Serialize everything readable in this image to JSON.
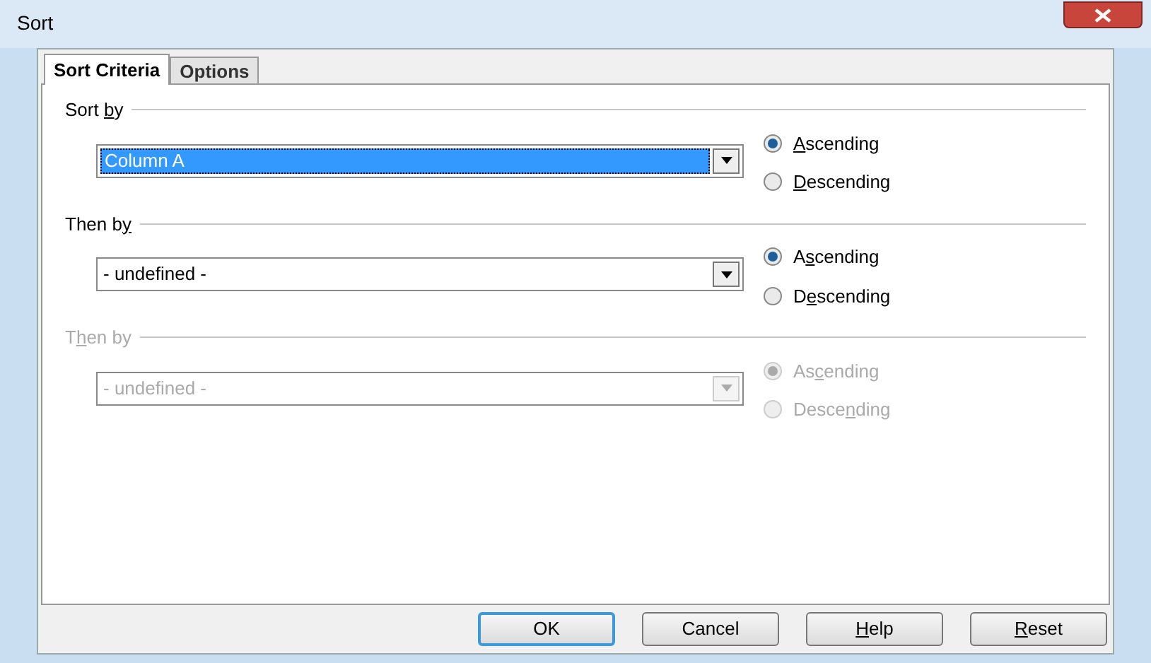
{
  "window": {
    "title": "Sort"
  },
  "tabs": [
    {
      "label": "Sort Criteria",
      "selected": true
    },
    {
      "label": "Options",
      "selected": false
    }
  ],
  "groups": [
    {
      "label": [
        {
          "text": "Sort ",
          "underline": false
        },
        {
          "text": "b",
          "underline": true
        },
        {
          "text": "y",
          "underline": false
        }
      ],
      "disabled": false,
      "combo": {
        "value": "Column A",
        "focused": true
      },
      "options": [
        {
          "label": [
            {
              "text": "A",
              "underline": true
            },
            {
              "text": "scending",
              "underline": false
            }
          ],
          "selected": true
        },
        {
          "label": [
            {
              "text": "D",
              "underline": true
            },
            {
              "text": "escending",
              "underline": false
            }
          ],
          "selected": false
        }
      ]
    },
    {
      "label": [
        {
          "text": "Then b",
          "underline": false
        },
        {
          "text": "y",
          "underline": true
        }
      ],
      "disabled": false,
      "combo": {
        "value": "- undefined -",
        "focused": false
      },
      "options": [
        {
          "label": [
            {
              "text": "A",
              "underline": false
            },
            {
              "text": "s",
              "underline": true
            },
            {
              "text": "cending",
              "underline": false
            }
          ],
          "selected": true
        },
        {
          "label": [
            {
              "text": "D",
              "underline": false
            },
            {
              "text": "e",
              "underline": true
            },
            {
              "text": "scending",
              "underline": false
            }
          ],
          "selected": false
        }
      ]
    },
    {
      "label": [
        {
          "text": "T",
          "underline": false
        },
        {
          "text": "h",
          "underline": true
        },
        {
          "text": "en by",
          "underline": false
        }
      ],
      "disabled": true,
      "combo": {
        "value": "- undefined -",
        "focused": false
      },
      "options": [
        {
          "label": [
            {
              "text": "As",
              "underline": false
            },
            {
              "text": "c",
              "underline": true
            },
            {
              "text": "ending",
              "underline": false
            }
          ],
          "selected": true
        },
        {
          "label": [
            {
              "text": "Desce",
              "underline": false
            },
            {
              "text": "n",
              "underline": true
            },
            {
              "text": "ding",
              "underline": false
            }
          ],
          "selected": false
        }
      ]
    }
  ],
  "buttons": [
    {
      "label": [
        {
          "text": "OK",
          "underline": false
        }
      ],
      "default": true
    },
    {
      "label": [
        {
          "text": "Cancel",
          "underline": false
        }
      ],
      "default": false
    },
    {
      "label": [
        {
          "text": "H",
          "underline": true
        },
        {
          "text": "elp",
          "underline": false
        }
      ],
      "default": false
    },
    {
      "label": [
        {
          "text": "R",
          "underline": true
        },
        {
          "text": "eset",
          "underline": false
        }
      ],
      "default": false
    }
  ]
}
